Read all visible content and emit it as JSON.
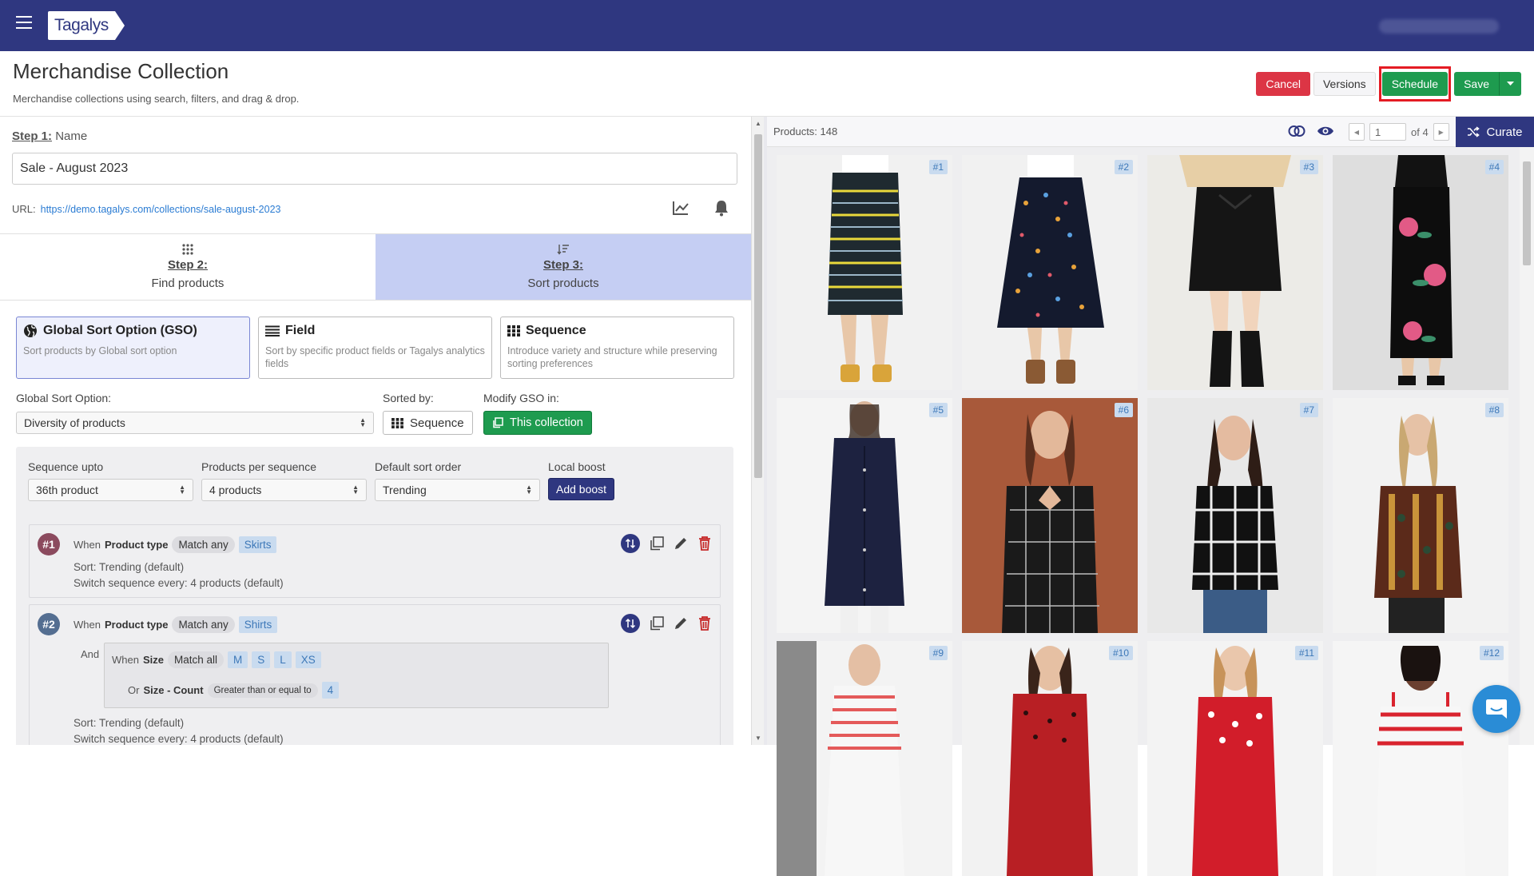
{
  "app": {
    "logo_text": "Tagalys"
  },
  "header": {
    "title": "Merchandise Collection",
    "subtitle": "Merchandise collections using search, filters, and drag & drop.",
    "buttons": {
      "cancel": "Cancel",
      "versions": "Versions",
      "schedule": "Schedule",
      "save": "Save"
    }
  },
  "step1": {
    "label": "Step 1:",
    "name_label": "Name",
    "name_value": "Sale - August 2023",
    "url_label": "URL:",
    "url": "https://demo.tagalys.com/collections/sale-august-2023"
  },
  "steps": [
    {
      "num": "Step 2:",
      "label": "Find products"
    },
    {
      "num": "Step 3:",
      "label": "Sort products"
    }
  ],
  "sort_options": [
    {
      "title": "Global Sort Option (GSO)",
      "desc": "Sort products by Global sort option"
    },
    {
      "title": "Field",
      "desc": "Sort by specific product fields or Tagalys analytics fields"
    },
    {
      "title": "Sequence",
      "desc": "Introduce variety and structure while preserving sorting preferences"
    }
  ],
  "gso": {
    "label": "Global Sort Option:",
    "value": "Diversity of products",
    "sorted_by_label": "Sorted by:",
    "sorted_by_value": "Sequence",
    "modify_label": "Modify GSO in:",
    "modify_value": "This collection"
  },
  "sequence": {
    "upto_label": "Sequence upto",
    "upto_value": "36th product",
    "per_label": "Products per sequence",
    "per_value": "4 products",
    "default_label": "Default sort order",
    "default_value": "Trending",
    "boost_label": "Local boost",
    "boost_button": "Add boost"
  },
  "rules": [
    {
      "badge": "#1",
      "when": "When",
      "field": "Product type",
      "match": "Match any",
      "tags": [
        "Skirts"
      ],
      "sort": "Sort: Trending (default)",
      "switch": "Switch sequence every: 4 products (default)"
    },
    {
      "badge": "#2",
      "when": "When",
      "field": "Product type",
      "match": "Match any",
      "tags": [
        "Shirts"
      ],
      "and": "And",
      "sub1": {
        "when": "When",
        "field": "Size",
        "match": "Match all",
        "tags": [
          "M",
          "S",
          "L",
          "XS"
        ]
      },
      "sub2": {
        "or": "Or",
        "field": "Size - Count",
        "op": "Greater than or equal to",
        "value": "4"
      },
      "sort": "Sort: Trending (default)",
      "switch": "Switch sequence every: 4 products (default)"
    }
  ],
  "products_panel": {
    "count": "Products: 148",
    "page": "1",
    "of": "of 4",
    "curate": "Curate",
    "cards": [
      "#1",
      "#2",
      "#3",
      "#4",
      "#5",
      "#6",
      "#7",
      "#8",
      "#9",
      "#10",
      "#11",
      "#12"
    ]
  },
  "colors": {
    "brand": "#2f3780",
    "green": "#1e9b4f",
    "red": "#dc3545",
    "highlight": "#e41b23",
    "step_active": "#c5cef3"
  }
}
